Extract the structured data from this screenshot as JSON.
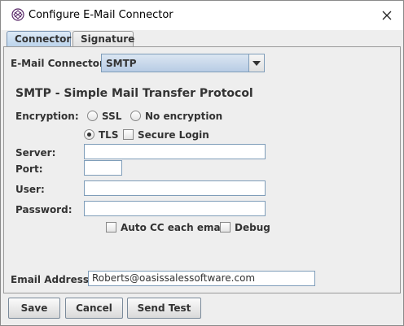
{
  "window": {
    "title": "Configure E-Mail Connector",
    "close_glyph": "✕"
  },
  "tabs": [
    {
      "label": "Connector",
      "active": true
    },
    {
      "label": "Signature",
      "active": false
    }
  ],
  "connector": {
    "label": "E-Mail Connector:",
    "selected": "SMTP"
  },
  "protocol_heading": "SMTP - Simple Mail Transfer Protocol",
  "encryption": {
    "label": "Encryption:",
    "options": [
      {
        "label": "SSL",
        "checked": false
      },
      {
        "label": "No encryption",
        "checked": false
      },
      {
        "label": "TLS",
        "checked": true
      }
    ],
    "secure_login": {
      "label": "Secure Login",
      "checked": false
    }
  },
  "fields": {
    "server": {
      "label": "Server:",
      "value": ""
    },
    "port": {
      "label": "Port:",
      "value": ""
    },
    "user": {
      "label": "User:",
      "value": ""
    },
    "password": {
      "label": "Password:",
      "value": ""
    }
  },
  "options": {
    "auto_cc": {
      "label": "Auto CC each email",
      "checked": false
    },
    "debug": {
      "label": "Debug",
      "checked": false
    }
  },
  "email_address": {
    "label": "Email Address:",
    "value": "Roberts@oasissalessoftware.com"
  },
  "buttons": {
    "save": "Save",
    "cancel": "Cancel",
    "send_test": "Send Test"
  },
  "colors": {
    "active_tab": "#bcd4ec",
    "combo_background": "#b8cce4",
    "field_border": "#7f9db9"
  },
  "icons": {
    "app": "gear-wheel-icon",
    "close": "close-icon",
    "dropdown": "chevron-down-icon"
  }
}
